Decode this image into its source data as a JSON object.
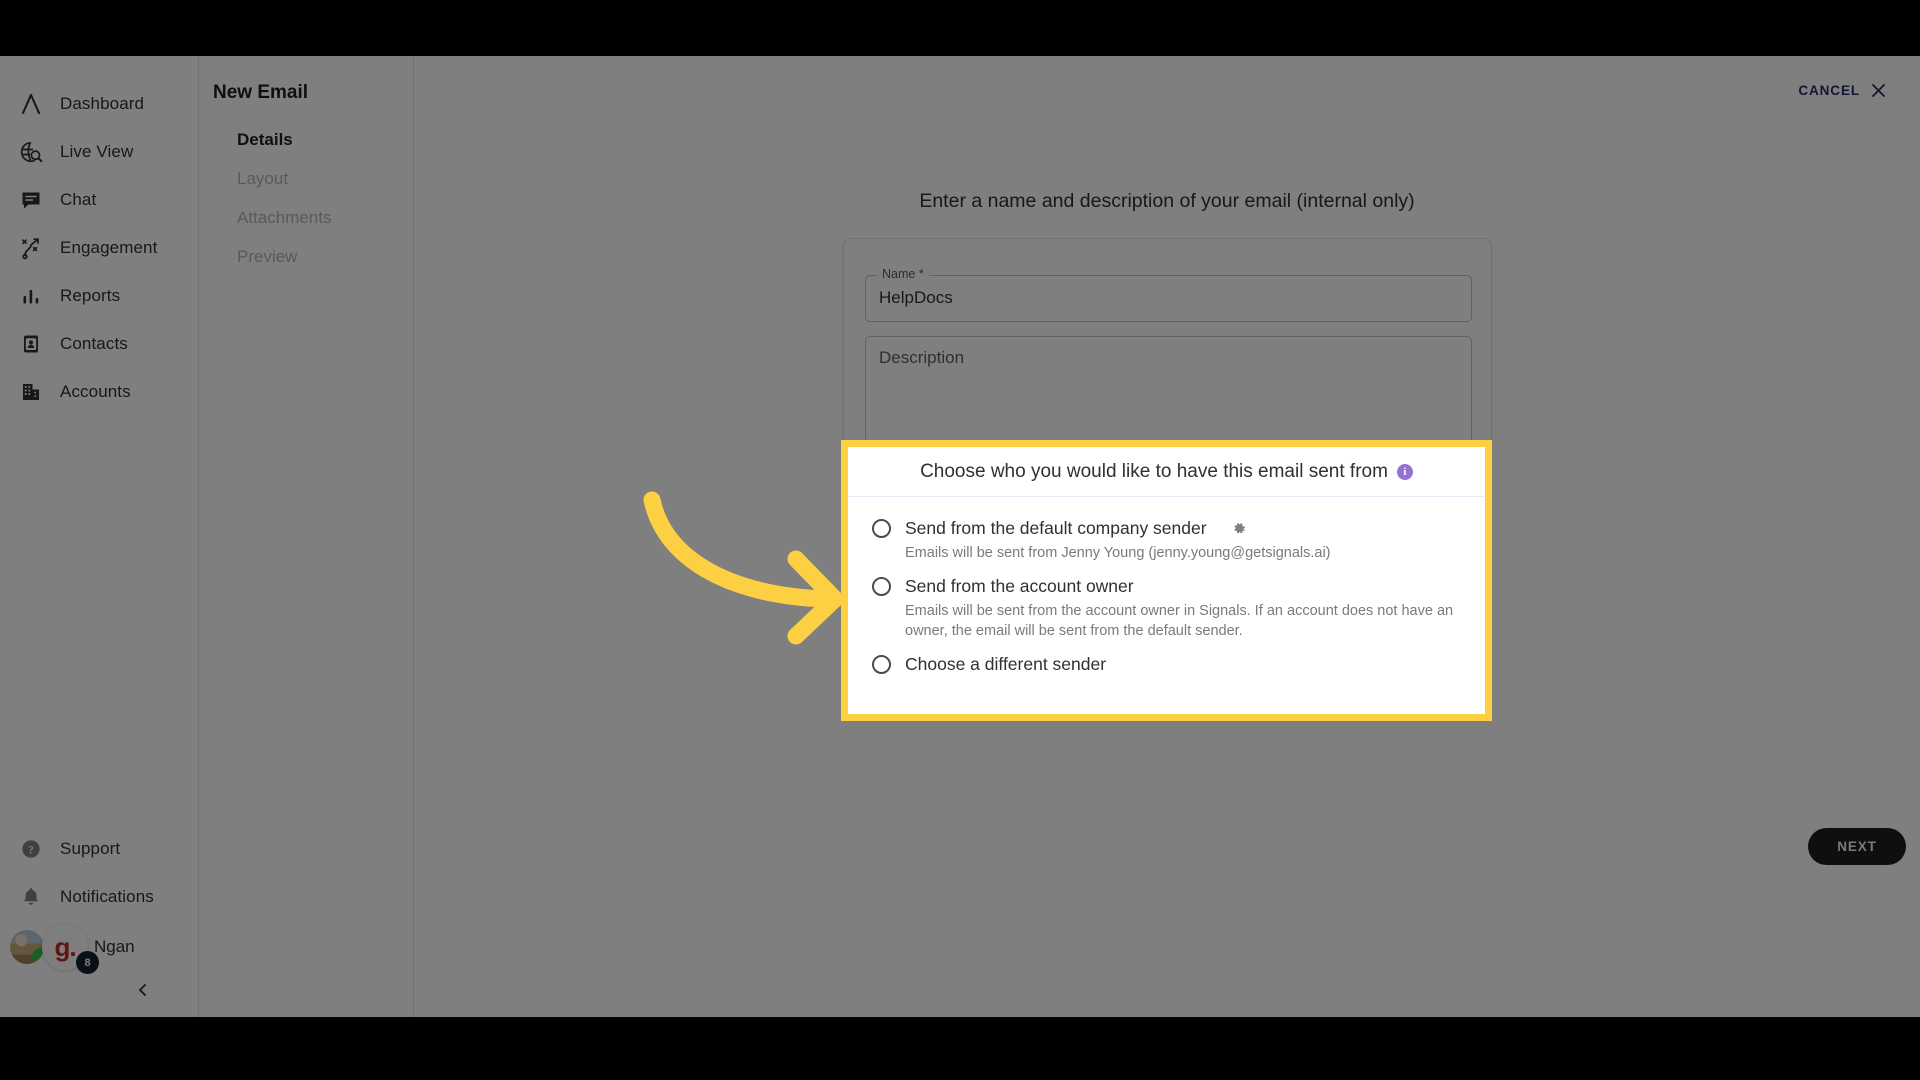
{
  "sidebar": {
    "items": [
      {
        "label": "Dashboard",
        "icon": "logo-chevron-icon"
      },
      {
        "label": "Live View",
        "icon": "globe-search-icon"
      },
      {
        "label": "Chat",
        "icon": "chat-bubble-icon"
      },
      {
        "label": "Engagement",
        "icon": "engagement-path-icon"
      },
      {
        "label": "Reports",
        "icon": "bar-chart-icon"
      },
      {
        "label": "Contacts",
        "icon": "contact-card-icon"
      },
      {
        "label": "Accounts",
        "icon": "building-icon"
      }
    ],
    "bottom_items": [
      {
        "label": "Support",
        "icon": "question-circle-icon"
      },
      {
        "label": "Notifications",
        "icon": "bell-icon"
      }
    ],
    "user": {
      "name": "Ngan",
      "grammarly_logo_text": "g.",
      "grammarly_badge_count": "8"
    },
    "collapse_icon": "chevron-left-icon"
  },
  "subpanel": {
    "title": "New Email",
    "steps": [
      {
        "label": "Details",
        "state": "active"
      },
      {
        "label": "Layout",
        "state": "inactive"
      },
      {
        "label": "Attachments",
        "state": "inactive"
      },
      {
        "label": "Preview",
        "state": "inactive"
      }
    ]
  },
  "header": {
    "cancel_label": "CANCEL",
    "cancel_icon": "close-icon"
  },
  "main": {
    "details_heading": "Enter a name and description of your email (internal only)",
    "name_field": {
      "label": "Name *",
      "value": "HelpDocs"
    },
    "description_field": {
      "placeholder": "Description",
      "value": ""
    },
    "sender_section": {
      "heading": "Choose who you would like to have this email sent from",
      "info_icon": "info-icon",
      "info_glyph": "i",
      "options": [
        {
          "label": "Send from the default company sender",
          "description": "Emails will be sent from Jenny Young (jenny.young@getsignals.ai)",
          "has_gear": true,
          "gear_icon": "gear-icon",
          "selected": false
        },
        {
          "label": "Send from the account owner",
          "description": "Emails will be sent from the account owner in Signals. If an account does not have an owner, the email will be sent from the default sender.",
          "has_gear": false,
          "selected": false
        },
        {
          "label": "Choose a different sender",
          "description": "",
          "has_gear": false,
          "selected": false
        }
      ]
    },
    "next_label": "NEXT"
  },
  "annotation": {
    "arrow_icon": "curved-arrow-icon",
    "highlight_color": "#fdd043",
    "arrow_color": "#fdd043"
  },
  "colors": {
    "accent_purple": "#9572d1",
    "cancel_navy": "#252a6b",
    "button_dark": "#1d1e20",
    "highlight_yellow": "#fdd043"
  }
}
